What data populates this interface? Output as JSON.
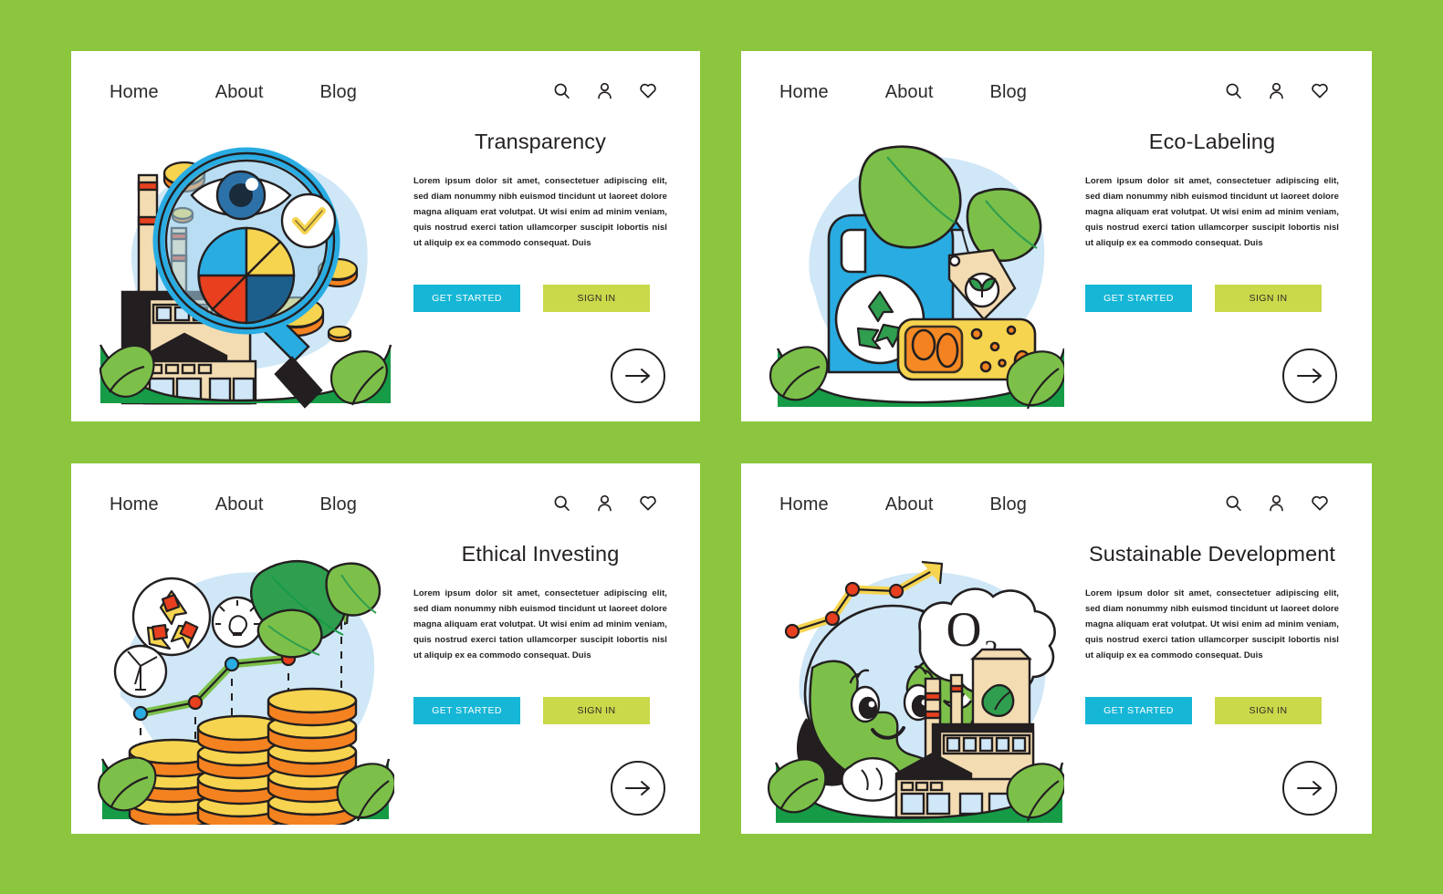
{
  "page": {
    "background_color": "#8CC63F",
    "card_background": "#ffffff"
  },
  "nav": {
    "links": [
      {
        "label": "Home",
        "name": "nav-link-home"
      },
      {
        "label": "About",
        "name": "nav-link-about"
      },
      {
        "label": "Blog",
        "name": "nav-link-blog"
      }
    ],
    "icons": [
      {
        "name": "search-icon",
        "glyph": "magnifier"
      },
      {
        "name": "user-icon",
        "glyph": "person"
      },
      {
        "name": "heart-icon",
        "glyph": "heart"
      }
    ]
  },
  "buttons": {
    "primary_label": "GET STARTED",
    "secondary_label": "SIGN IN",
    "primary_color": "#15b6d6",
    "secondary_color": "#cad94a",
    "arrow_label": "next"
  },
  "body_text": "Lorem ipsum dolor sit amet, consectetuer adipiscing elit, sed diam nonummy nibh euismod tincidunt ut laoreet dolore magna aliquam erat volutpat. Ut wisi enim ad minim veniam, quis nostrud exerci tation ullamcorper suscipit lobortis nisl ut aliquip ex ea commodo consequat. Duis",
  "cards": [
    {
      "id": "transparency",
      "title": "Transparency",
      "illustration": "factory-magnifier-eye-pie-coins"
    },
    {
      "id": "eco-labeling",
      "title": "Eco-Labeling",
      "illustration": "bottle-recycle-leaf-tag-sponge"
    },
    {
      "id": "ethical-investing",
      "title": "Ethical Investing",
      "illustration": "coin-stacks-growth-chart-icons"
    },
    {
      "id": "sustainable-development",
      "title": "Sustainable Development",
      "illustration": "earth-character-factory-o2-cloud",
      "cloud_label": "O",
      "cloud_sub": "2"
    }
  ],
  "palette": {
    "sky": "#cfe7f7",
    "grass": "#169b47",
    "leaf_light": "#7cc04a",
    "leaf_dark": "#2f9e4f",
    "blue": "#29ace2",
    "navy": "#1c5f8c",
    "yellow": "#f6d44f",
    "orange": "#f58220",
    "red": "#e8401f",
    "beige": "#f3dcb2",
    "outline": "#231f20"
  }
}
